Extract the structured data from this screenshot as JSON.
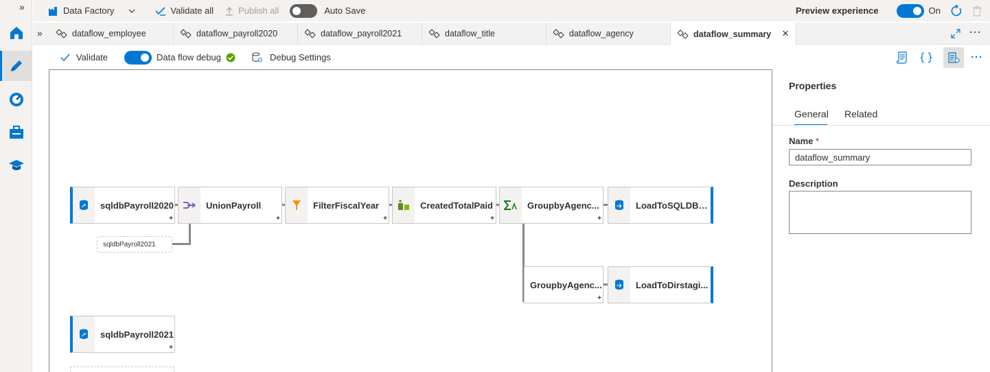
{
  "rail": {
    "collapse_glyph": "»",
    "items": [
      "home-icon",
      "author-pencil-icon",
      "monitor-gauge-icon",
      "manage-toolbox-icon",
      "learning-hat-icon"
    ]
  },
  "topbar": {
    "factory_label": "Data Factory",
    "validate_all": "Validate all",
    "publish_all": "Publish all",
    "auto_save": "Auto Save",
    "preview_experience": "Preview experience",
    "preview_state": "On"
  },
  "tabs": {
    "collapse_glyph": "»",
    "items": [
      "dataflow_employee",
      "dataflow_payroll2020",
      "dataflow_payroll2021",
      "dataflow_title",
      "dataflow_agency",
      "dataflow_summary"
    ],
    "close_glyph": "×",
    "more_glyph": "···"
  },
  "toolbar": {
    "validate": "Validate",
    "dataflow_debug": "Data flow debug",
    "debug_settings": "Debug Settings",
    "more_glyph": "···"
  },
  "canvas": {
    "nodes": {
      "src1": "sqldbPayroll2020",
      "union": "UnionPayroll",
      "filter": "FilterFiscalYear",
      "derived": "CreatedTotalPaid",
      "group1": "GroupbyAgenc...",
      "sink1": "LoadToSQLDBS...",
      "group2": "GroupbyAgenc...",
      "sink2": "LoadToDirstagi...",
      "src2": "sqldbPayroll2021",
      "union_ref": "sqldbPayroll2021"
    },
    "plus_glyph": "+"
  },
  "properties": {
    "title": "Properties",
    "tab_general": "General",
    "tab_related": "Related",
    "name_label": "Name",
    "required_mark": "*",
    "name_value": "dataflow_summary",
    "description_label": "Description",
    "description_value": ""
  },
  "colors": {
    "accent": "#0078d4",
    "rail_bg": "#f3f2f1",
    "success": "#57a300"
  }
}
